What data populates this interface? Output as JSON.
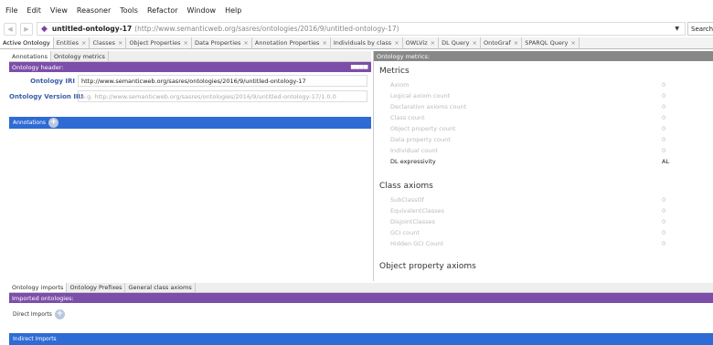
{
  "menu": [
    "File",
    "Edit",
    "View",
    "Reasoner",
    "Tools",
    "Refactor",
    "Window",
    "Help"
  ],
  "toolbar": {
    "back_label": "◀",
    "forward_label": "▶",
    "ontology_name": "untitled-ontology-17",
    "ontology_iri": "(http://www.semanticweb.org/sasres/ontologies/2016/9/untitled-ontology-17)",
    "search_label": "Search..."
  },
  "tabs": [
    {
      "label": "Active Ontology"
    },
    {
      "label": "Entities"
    },
    {
      "label": "Classes"
    },
    {
      "label": "Object Properties"
    },
    {
      "label": "Data Properties"
    },
    {
      "label": "Annotation Properties"
    },
    {
      "label": "Individuals by class"
    },
    {
      "label": "OWLViz"
    },
    {
      "label": "DL Query"
    },
    {
      "label": "OntoGraf"
    },
    {
      "label": "SPARQL Query"
    }
  ],
  "left": {
    "subtabs": [
      "Annotations",
      "Ontology metrics"
    ],
    "header_label": "Ontology header:",
    "iri_label": "Ontology IRI",
    "iri_value": "http://www.semanticweb.org/sasres/ontologies/2016/9/untitled-ontology-17",
    "version_label": "Ontology Version IRI",
    "version_placeholder": "e.g. http://www.semanticweb.org/sasres/ontologies/2016/9/untitled-ontology-17/1.0.0",
    "annotations_label": "Annotations"
  },
  "right": {
    "header_label": "Ontology metrics:",
    "metrics_title": "Metrics",
    "metrics": [
      {
        "label": "Axiom",
        "value": "0"
      },
      {
        "label": "Logical axiom count",
        "value": "0"
      },
      {
        "label": "Declaration axioms count",
        "value": "0"
      },
      {
        "label": "Class count",
        "value": "0"
      },
      {
        "label": "Object property count",
        "value": "0"
      },
      {
        "label": "Data property count",
        "value": "0"
      },
      {
        "label": "Individual count",
        "value": "0"
      },
      {
        "label": "DL expressivity",
        "value": "AL"
      }
    ],
    "class_axioms_title": "Class axioms",
    "class_axioms": [
      {
        "label": "SubClassOf",
        "value": "0"
      },
      {
        "label": "EquivalentClasses",
        "value": "0"
      },
      {
        "label": "DisjointClasses",
        "value": "0"
      },
      {
        "label": "GCI count",
        "value": "0"
      },
      {
        "label": "Hidden GCI Count",
        "value": "0"
      }
    ],
    "object_property_axioms_title": "Object property axioms"
  },
  "bottom": {
    "subtabs": [
      "Ontology imports",
      "Ontology Prefixes",
      "General class axioms"
    ],
    "header_label": "Imported ontologies:",
    "direct_imports_label": "Direct Imports",
    "indirect_imports_label": "Indirect Imports"
  }
}
